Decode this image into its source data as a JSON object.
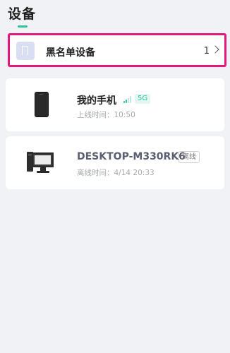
{
  "header": {
    "title": "设备"
  },
  "blacklist": {
    "label": "黑名单设备",
    "count": "1"
  },
  "devices": [
    {
      "name": "我的手机",
      "network": "5G",
      "online_time": "上线时间：10:50",
      "type_icon": "phone-icon",
      "signal_level": 2,
      "signal_max": 4
    },
    {
      "name": "DESKTOP-M330RK6",
      "status": "离线",
      "offline_time": "离线时间：4/14 20:33",
      "type_icon": "desktop-computer-icon"
    }
  ],
  "colors": {
    "accent": "#2bc4a0",
    "highlight_border": "#e5187d",
    "background": "#f1f2f5"
  }
}
